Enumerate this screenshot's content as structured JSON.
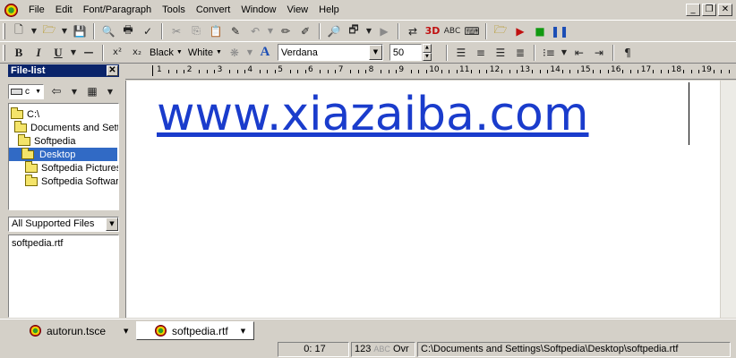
{
  "menubar": {
    "items": [
      "File",
      "Edit",
      "Font/Paragraph",
      "Tools",
      "Convert",
      "Window",
      "View",
      "Help"
    ]
  },
  "format_toolbar": {
    "text_color": "Black",
    "background_color": "White",
    "font_name": "Verdana",
    "font_size": "50"
  },
  "file_pane": {
    "title": "File-list",
    "drive": "c",
    "tree": [
      {
        "label": "C:\\"
      },
      {
        "label": "Documents and Settings"
      },
      {
        "label": "Softpedia"
      },
      {
        "label": "Desktop"
      },
      {
        "label": "Softpedia Pictures"
      },
      {
        "label": "Softpedia Software"
      }
    ],
    "filter": "All Supported Files",
    "files": [
      "softpedia.rtf"
    ]
  },
  "ruler": {
    "numbers": [
      "1",
      "2",
      "3",
      "4",
      "5",
      "6",
      "7",
      "8",
      "9",
      "10",
      "11",
      "12",
      "13",
      "14",
      "15",
      "16",
      "17",
      "18",
      "19"
    ]
  },
  "document": {
    "content": "www.xiazaiba.com",
    "text_color": "#1a3ccc"
  },
  "tabs": [
    {
      "label": "autorun.tsce"
    },
    {
      "label": "softpedia.rtf"
    }
  ],
  "statusbar": {
    "position": "0: 17",
    "line_count": "123",
    "caps": "ABC",
    "mode": "Ovr",
    "path": "C:\\Documents and Settings\\Softpedia\\Desktop\\softpedia.rtf"
  }
}
